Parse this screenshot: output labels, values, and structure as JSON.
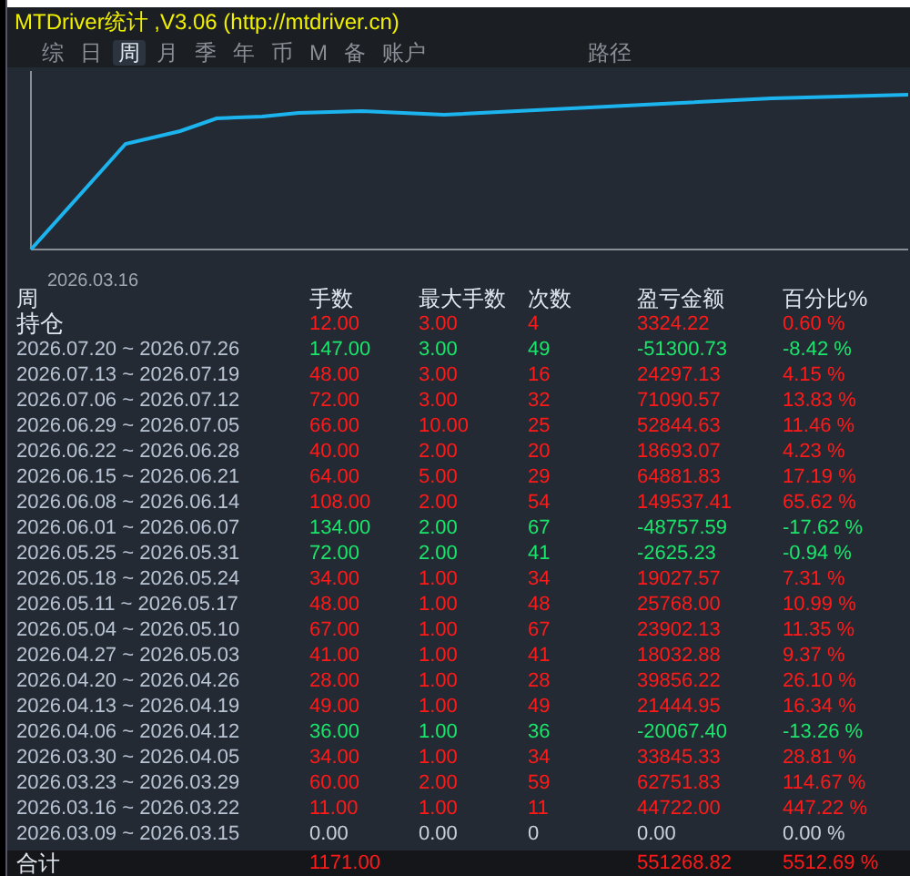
{
  "window": {
    "title": "MTDriver统计 ,V3.06 (http://mtdriver.cn)"
  },
  "tabs": [
    {
      "label": "综",
      "selected": false
    },
    {
      "label": "日",
      "selected": false
    },
    {
      "label": "周",
      "selected": true
    },
    {
      "label": "月",
      "selected": false
    },
    {
      "label": "季",
      "selected": false
    },
    {
      "label": "年",
      "selected": false
    },
    {
      "label": "币",
      "selected": false
    },
    {
      "label": "M",
      "selected": false
    },
    {
      "label": "备",
      "selected": false
    },
    {
      "label": "账户",
      "selected": false
    },
    {
      "label": "路径",
      "selected": false
    }
  ],
  "chart": {
    "start_label": "2026.03.16"
  },
  "table": {
    "columns": [
      "周",
      "手数",
      "最大手数",
      "次数",
      "盈亏金额",
      "百分比%"
    ],
    "rows": [
      {
        "kind": "gain",
        "cells": [
          "持仓",
          "12.00",
          "3.00",
          "4",
          "3324.22",
          "0.60 %"
        ]
      },
      {
        "kind": "loss",
        "cells": [
          "2026.07.20 ~ 2026.07.26",
          "147.00",
          "3.00",
          "49",
          "-51300.73",
          "-8.42 %"
        ]
      },
      {
        "kind": "gain",
        "cells": [
          "2026.07.13 ~ 2026.07.19",
          "48.00",
          "3.00",
          "16",
          "24297.13",
          "4.15 %"
        ]
      },
      {
        "kind": "gain",
        "cells": [
          "2026.07.06 ~ 2026.07.12",
          "72.00",
          "3.00",
          "32",
          "71090.57",
          "13.83 %"
        ]
      },
      {
        "kind": "gain",
        "cells": [
          "2026.06.29 ~ 2026.07.05",
          "66.00",
          "10.00",
          "25",
          "52844.63",
          "11.46 %"
        ]
      },
      {
        "kind": "gain",
        "cells": [
          "2026.06.22 ~ 2026.06.28",
          "40.00",
          "2.00",
          "20",
          "18693.07",
          "4.23 %"
        ]
      },
      {
        "kind": "gain",
        "cells": [
          "2026.06.15 ~ 2026.06.21",
          "64.00",
          "5.00",
          "29",
          "64881.83",
          "17.19 %"
        ]
      },
      {
        "kind": "gain",
        "cells": [
          "2026.06.08 ~ 2026.06.14",
          "108.00",
          "2.00",
          "54",
          "149537.41",
          "65.62 %"
        ]
      },
      {
        "kind": "loss",
        "cells": [
          "2026.06.01 ~ 2026.06.07",
          "134.00",
          "2.00",
          "67",
          "-48757.59",
          "-17.62 %"
        ]
      },
      {
        "kind": "loss",
        "cells": [
          "2026.05.25 ~ 2026.05.31",
          "72.00",
          "2.00",
          "41",
          "-2625.23",
          "-0.94 %"
        ]
      },
      {
        "kind": "gain",
        "cells": [
          "2026.05.18 ~ 2026.05.24",
          "34.00",
          "1.00",
          "34",
          "19027.57",
          "7.31 %"
        ]
      },
      {
        "kind": "gain",
        "cells": [
          "2026.05.11 ~ 2026.05.17",
          "48.00",
          "1.00",
          "48",
          "25768.00",
          "10.99 %"
        ]
      },
      {
        "kind": "gain",
        "cells": [
          "2026.05.04 ~ 2026.05.10",
          "67.00",
          "1.00",
          "67",
          "23902.13",
          "11.35 %"
        ]
      },
      {
        "kind": "gain",
        "cells": [
          "2026.04.27 ~ 2026.05.03",
          "41.00",
          "1.00",
          "41",
          "18032.88",
          "9.37 %"
        ]
      },
      {
        "kind": "gain",
        "cells": [
          "2026.04.20 ~ 2026.04.26",
          "28.00",
          "1.00",
          "28",
          "39856.22",
          "26.10 %"
        ]
      },
      {
        "kind": "gain",
        "cells": [
          "2026.04.13 ~ 2026.04.19",
          "49.00",
          "1.00",
          "49",
          "21444.95",
          "16.34 %"
        ]
      },
      {
        "kind": "loss",
        "cells": [
          "2026.04.06 ~ 2026.04.12",
          "36.00",
          "1.00",
          "36",
          "-20067.40",
          "-13.26 %"
        ]
      },
      {
        "kind": "gain",
        "cells": [
          "2026.03.30 ~ 2026.04.05",
          "34.00",
          "1.00",
          "34",
          "33845.33",
          "28.81 %"
        ]
      },
      {
        "kind": "gain",
        "cells": [
          "2026.03.23 ~ 2026.03.29",
          "60.00",
          "2.00",
          "59",
          "62751.83",
          "114.67 %"
        ]
      },
      {
        "kind": "gain",
        "cells": [
          "2026.03.16 ~ 2026.03.22",
          "11.00",
          "1.00",
          "11",
          "44722.00",
          "447.22 %"
        ]
      },
      {
        "kind": "flat",
        "cells": [
          "2026.03.09 ~ 2026.03.15",
          "0.00",
          "0.00",
          "0",
          "0.00",
          "0.00 %"
        ]
      }
    ],
    "total": {
      "label": "合计",
      "lots": "1171.00",
      "pnl": "551268.82",
      "pct": "5512.69 %"
    }
  }
}
